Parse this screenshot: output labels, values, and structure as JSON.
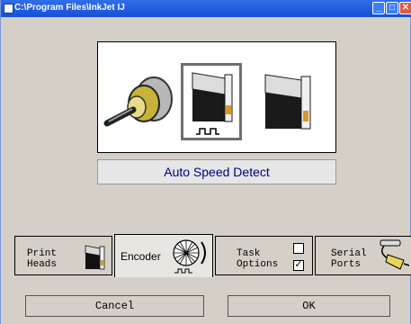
{
  "window": {
    "title": "C:\\Program Files\\InkJet   IJ",
    "minimize_glyph": "_",
    "maximize_glyph": "□",
    "close_glyph": "✕"
  },
  "mode": {
    "label": "Auto Speed Detect",
    "devices": [
      "knob-encoder-icon",
      "speed-device-icon",
      "device-icon"
    ]
  },
  "tabs": [
    {
      "line1": "Print",
      "line2": "Heads",
      "icon": "print-head-icon"
    },
    {
      "line1": "Encoder",
      "line2": "",
      "icon": "encoder-wheel-icon"
    },
    {
      "line1": "Task",
      "line2": "Options",
      "icon": "checkbox-icon"
    },
    {
      "line1": "Serial",
      "line2": "Ports",
      "icon": "serial-cable-icon"
    }
  ],
  "buttons": {
    "cancel": "Cancel",
    "ok": "OK"
  },
  "colors": {
    "title_bar": "#2f6ee8",
    "mode_text": "#00007a",
    "window_bg": "#d4d0c8"
  }
}
